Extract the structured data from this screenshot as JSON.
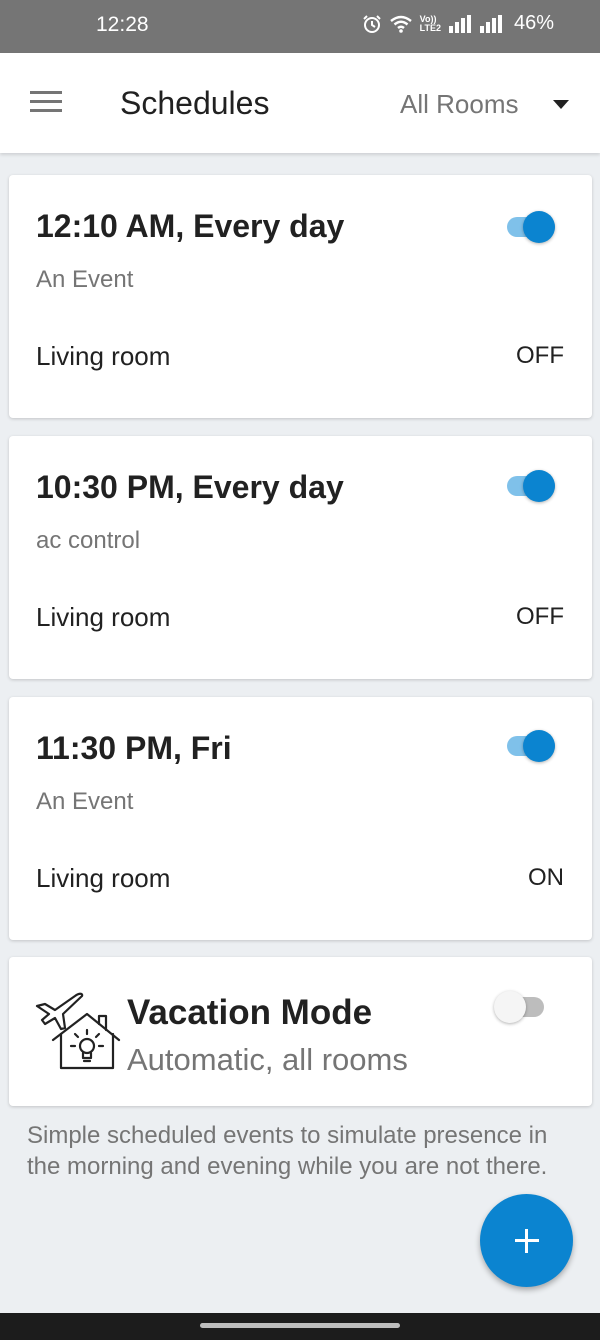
{
  "status_bar": {
    "time": "12:28",
    "icons": [
      "alarm-icon",
      "wifi-icon",
      "volte-icon",
      "signal-icon",
      "signal-icon"
    ],
    "volte_top": "Vo))",
    "volte_bottom": "LTE2",
    "battery": "46%"
  },
  "app_bar": {
    "title": "Schedules",
    "room_filter": "All Rooms"
  },
  "schedules": [
    {
      "time": "12:10 AM, Every day",
      "name": "An Event",
      "room": "Living room",
      "state": "OFF",
      "enabled": true
    },
    {
      "time": "10:30 PM, Every day",
      "name": "ac control",
      "room": "Living room",
      "state": "OFF",
      "enabled": true
    },
    {
      "time": "11:30 PM, Fri",
      "name": "An Event",
      "room": "Living room",
      "state": "ON",
      "enabled": true
    }
  ],
  "vacation": {
    "title": "Vacation Mode",
    "subtitle": "Automatic, all rooms",
    "enabled": false
  },
  "help_text": "Simple scheduled events to simulate presence in the morning and evening while you are not there.",
  "colors": {
    "accent": "#0b84d0",
    "accent_light": "#7fc1ea",
    "status_bar": "#757575",
    "background": "#eceff2"
  }
}
